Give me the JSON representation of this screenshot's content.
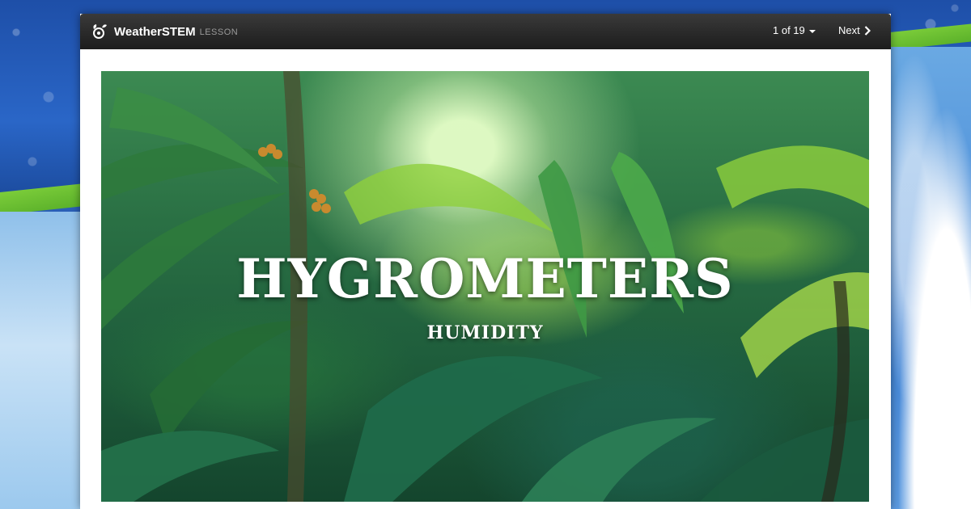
{
  "header": {
    "brand_name": "WeatherSTEM",
    "brand_sub": "LESSON",
    "pager_label": "1 of 19",
    "next_label": "Next"
  },
  "hero": {
    "title": "HYGROMETERS",
    "subtitle": "HUMIDITY"
  },
  "icons": {
    "brand": "weatherstem-logo-icon",
    "pager": "caret-down-icon",
    "next": "chevron-right-icon"
  },
  "colors": {
    "topbar": "#1c1c1c",
    "brand_sub": "#9a9a9a",
    "panel": "#ffffff",
    "background_blue": "#2a5fb6",
    "accent_green": "#6bbf30"
  }
}
